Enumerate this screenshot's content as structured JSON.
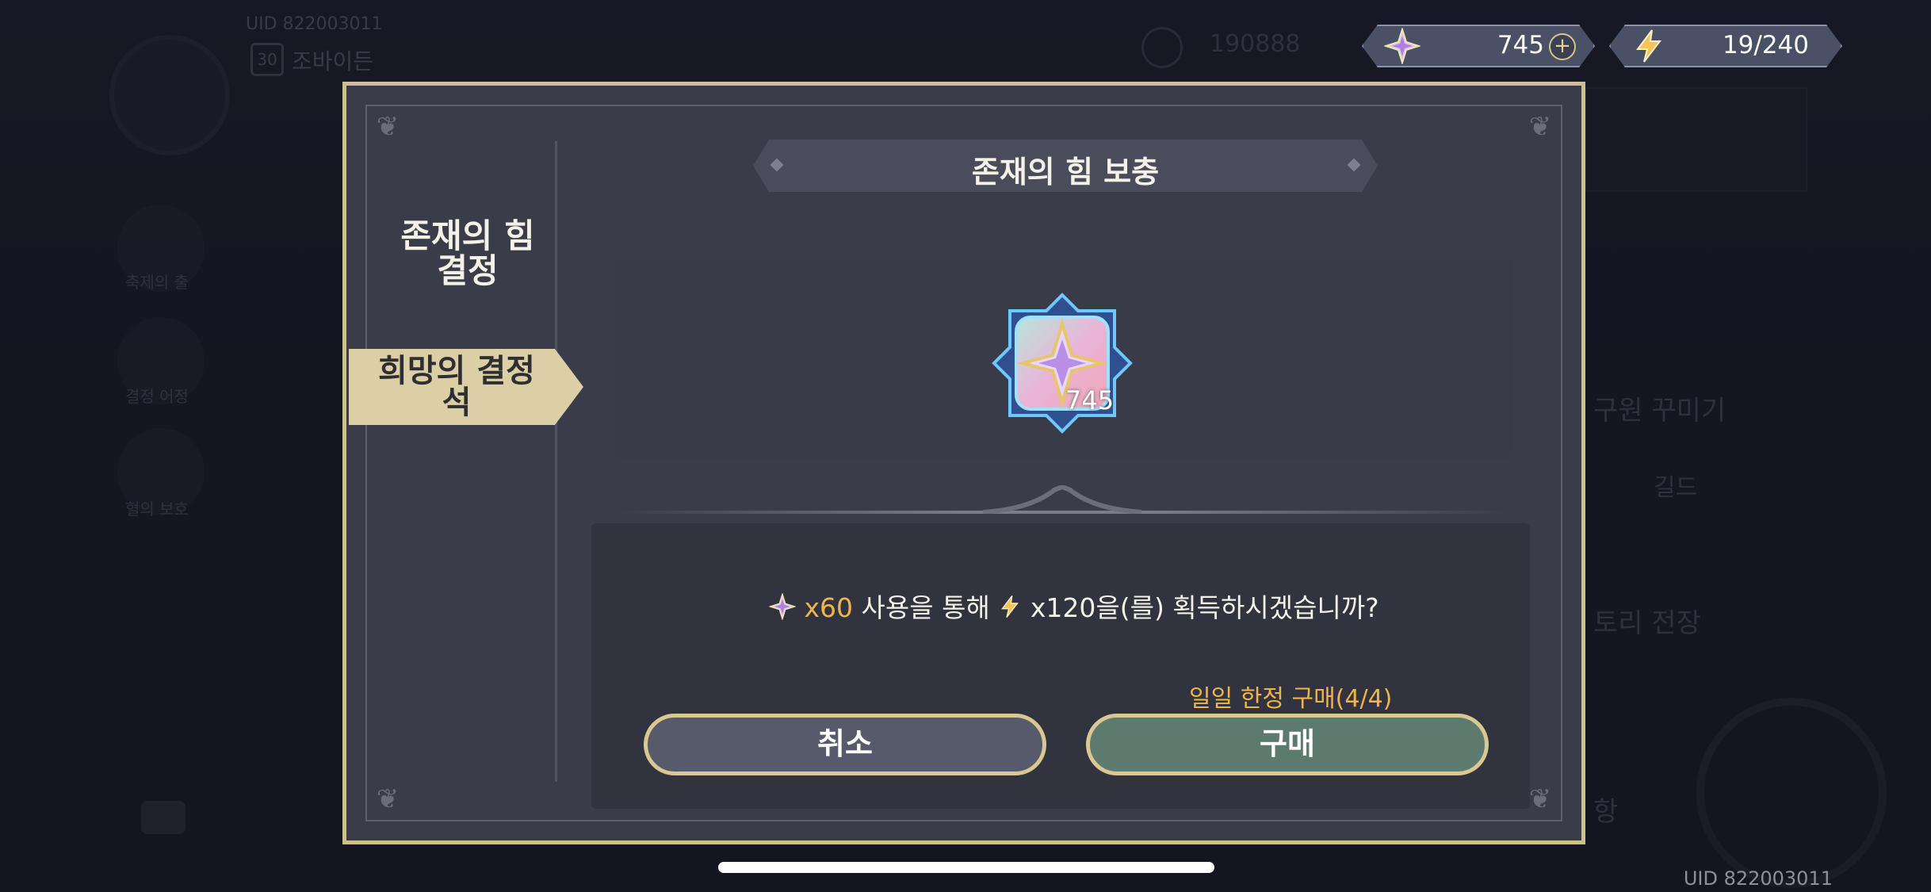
{
  "hud": {
    "crystal_value": "745",
    "stamina_value": "19/240",
    "bg_uid": "UID 822003011",
    "bg_level": "30",
    "bg_name": "조바이든",
    "bg_gold": "190888",
    "bg_side_labels": [
      "축제의 출",
      "결정 어정",
      "혈의 보호"
    ],
    "bg_right_labels": [
      "구원 꾸미기",
      "길드",
      "토리 전장",
      "항"
    ]
  },
  "modal": {
    "tabs": [
      {
        "label_line1": "존재의 힘",
        "label_line2": "결정",
        "active": false
      },
      {
        "label_line1": "희망의 결정",
        "label_line2": "석",
        "active": true
      }
    ],
    "title": "존재의 힘 보충",
    "item_count": "745",
    "question": {
      "cost": "x60",
      "middle": "사용을 통해",
      "reward": "x120을(를) 획득하시겠습니까?"
    },
    "daily_limit": "일일 한정 구매(4/4)",
    "cancel_label": "취소",
    "buy_label": "구매"
  },
  "footer": {
    "uid": "UID 822003011"
  },
  "colors": {
    "accent_gold": "#cdbf8e",
    "highlight_orange": "#f0b44a",
    "buy_green": "#5d7a6e",
    "cancel_gray": "#565a6b"
  },
  "icons": [
    "crystal-icon",
    "lightning-icon",
    "plus-icon"
  ]
}
